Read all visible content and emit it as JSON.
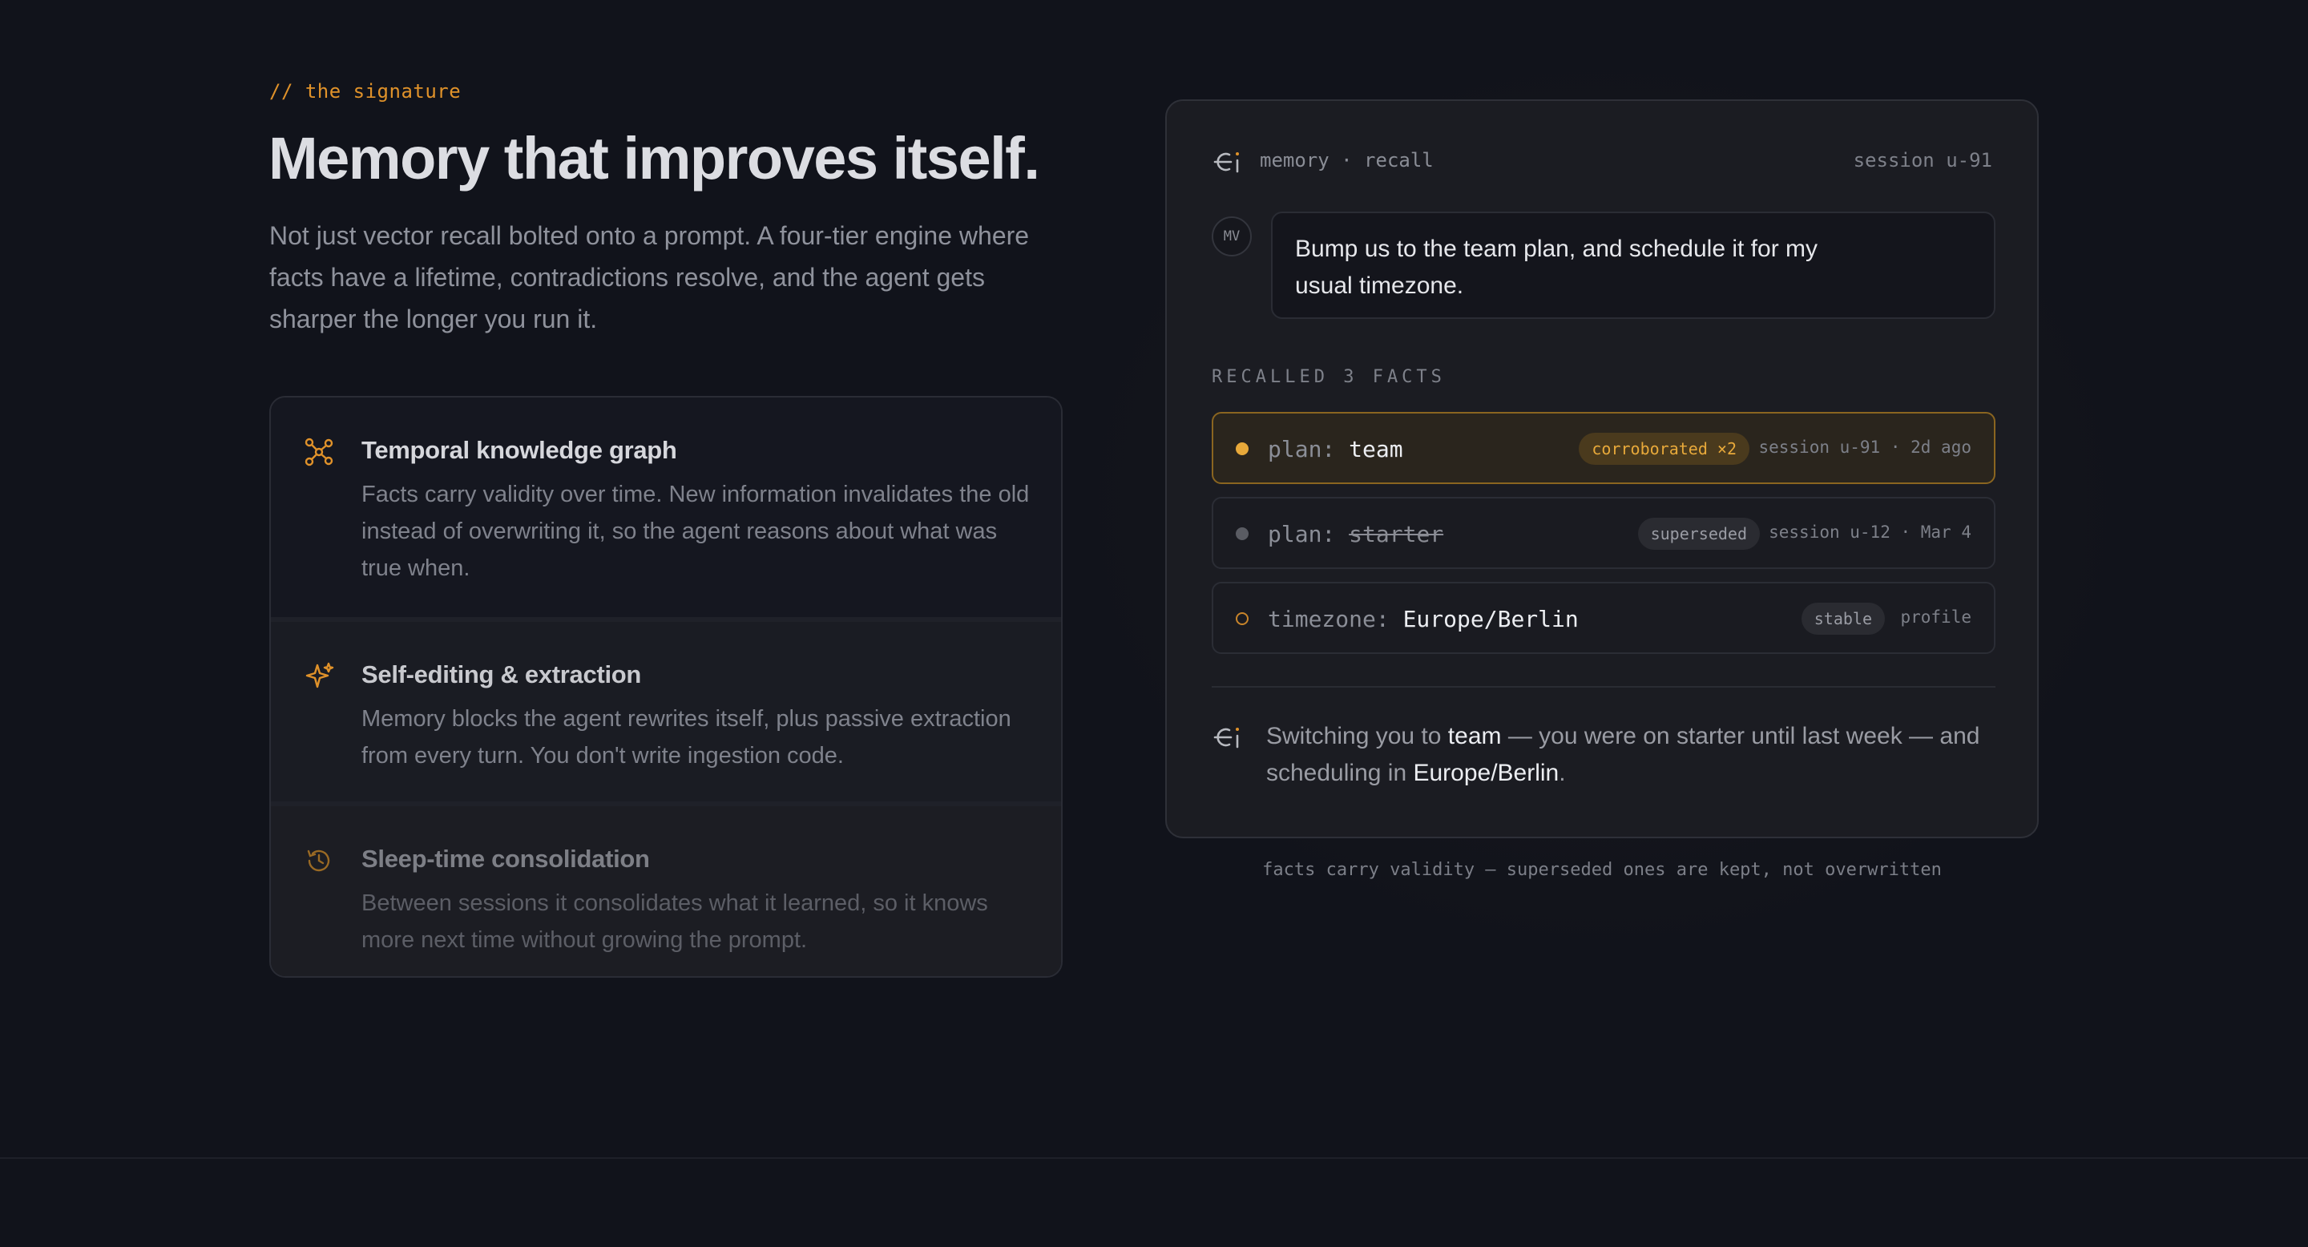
{
  "section": {
    "eyebrow": "// the signature",
    "headline": "Memory that improves itself.",
    "lead": "Not just vector recall bolted onto a prompt. A four-tier engine where facts have a lifetime, contradictions resolve, and the agent gets sharper the longer you run it."
  },
  "features": [
    {
      "icon": "graph-icon",
      "title": "Temporal knowledge graph",
      "description": "Facts carry validity over time. New information invalidates the old instead of overwriting it, so the agent reasons about what was true when."
    },
    {
      "icon": "sparkle-icon",
      "title": "Self-editing & extraction",
      "description": "Memory blocks the agent rewrites itself, plus passive extraction from every turn. You don't write ingestion code."
    },
    {
      "icon": "history-icon",
      "title": "Sleep-time consolidation",
      "description": "Between sessions it consolidates what it learned, so it knows more next time without growing the prompt."
    }
  ],
  "card": {
    "label": "memory · recall",
    "session": "session u-91",
    "avatar": "MV",
    "user_message": "Bump us to the team plan, and schedule it for my usual timezone.",
    "recalled_label": "RECALLED 3 FACTS",
    "facts": [
      {
        "key": "plan:",
        "value": "team",
        "badge": "corroborated ×2",
        "meta": "session u-91 · 2d ago",
        "state": "active"
      },
      {
        "key": "plan:",
        "value": "starter",
        "badge": "superseded",
        "meta": "session u-12 · Mar 4",
        "state": "superseded"
      },
      {
        "key": "timezone:",
        "value": "Europe/Berlin",
        "badge": "stable",
        "meta": "profile",
        "state": "stable"
      }
    ],
    "reply": {
      "p1": "Switching you to ",
      "h1": "team",
      "p2": " — you were on starter until last week — and scheduling in ",
      "h2": "Europe/Berlin",
      "p3": "."
    }
  },
  "caption": "facts carry validity — superseded ones are kept, not overwritten",
  "colors": {
    "background": "#11131b",
    "accent": "#e0922a",
    "card": "#1b1c22"
  }
}
